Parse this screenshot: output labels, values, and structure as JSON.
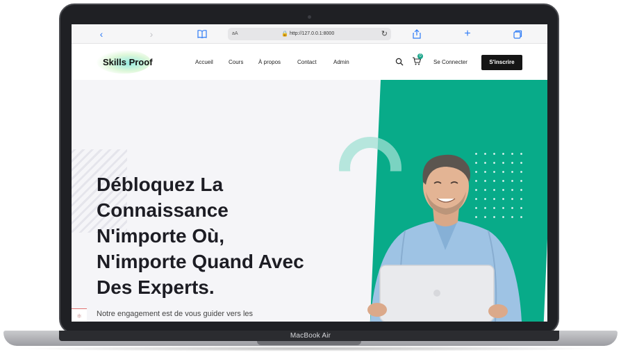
{
  "device": {
    "label": "MacBook Air"
  },
  "browser": {
    "address": {
      "text_size_label": "aA",
      "url": "http://127.0.0.1:8000"
    },
    "icons": [
      "back-icon",
      "forward-icon",
      "bookmarks-icon",
      "lock-icon",
      "reload-icon",
      "share-icon",
      "new-tab-icon",
      "tabs-icon"
    ]
  },
  "site": {
    "logo_text": "Skills Proof",
    "nav": [
      "Accueil",
      "Cours",
      "À propos",
      "Contact",
      "Admin"
    ],
    "cart_count": "0",
    "login_label": "Se Connecter",
    "signup_label": "S'inscrire"
  },
  "hero": {
    "headline_lines": [
      "Débloquez La",
      "Connaissance",
      "N'importe Où,",
      "N'importe Quand Avec",
      "Des Experts."
    ],
    "subline": "Notre engagement est de vous guider vers les"
  },
  "colors": {
    "accent": "#08ab89",
    "dark_button": "#151515",
    "hero_bg": "#f5f5f8"
  }
}
